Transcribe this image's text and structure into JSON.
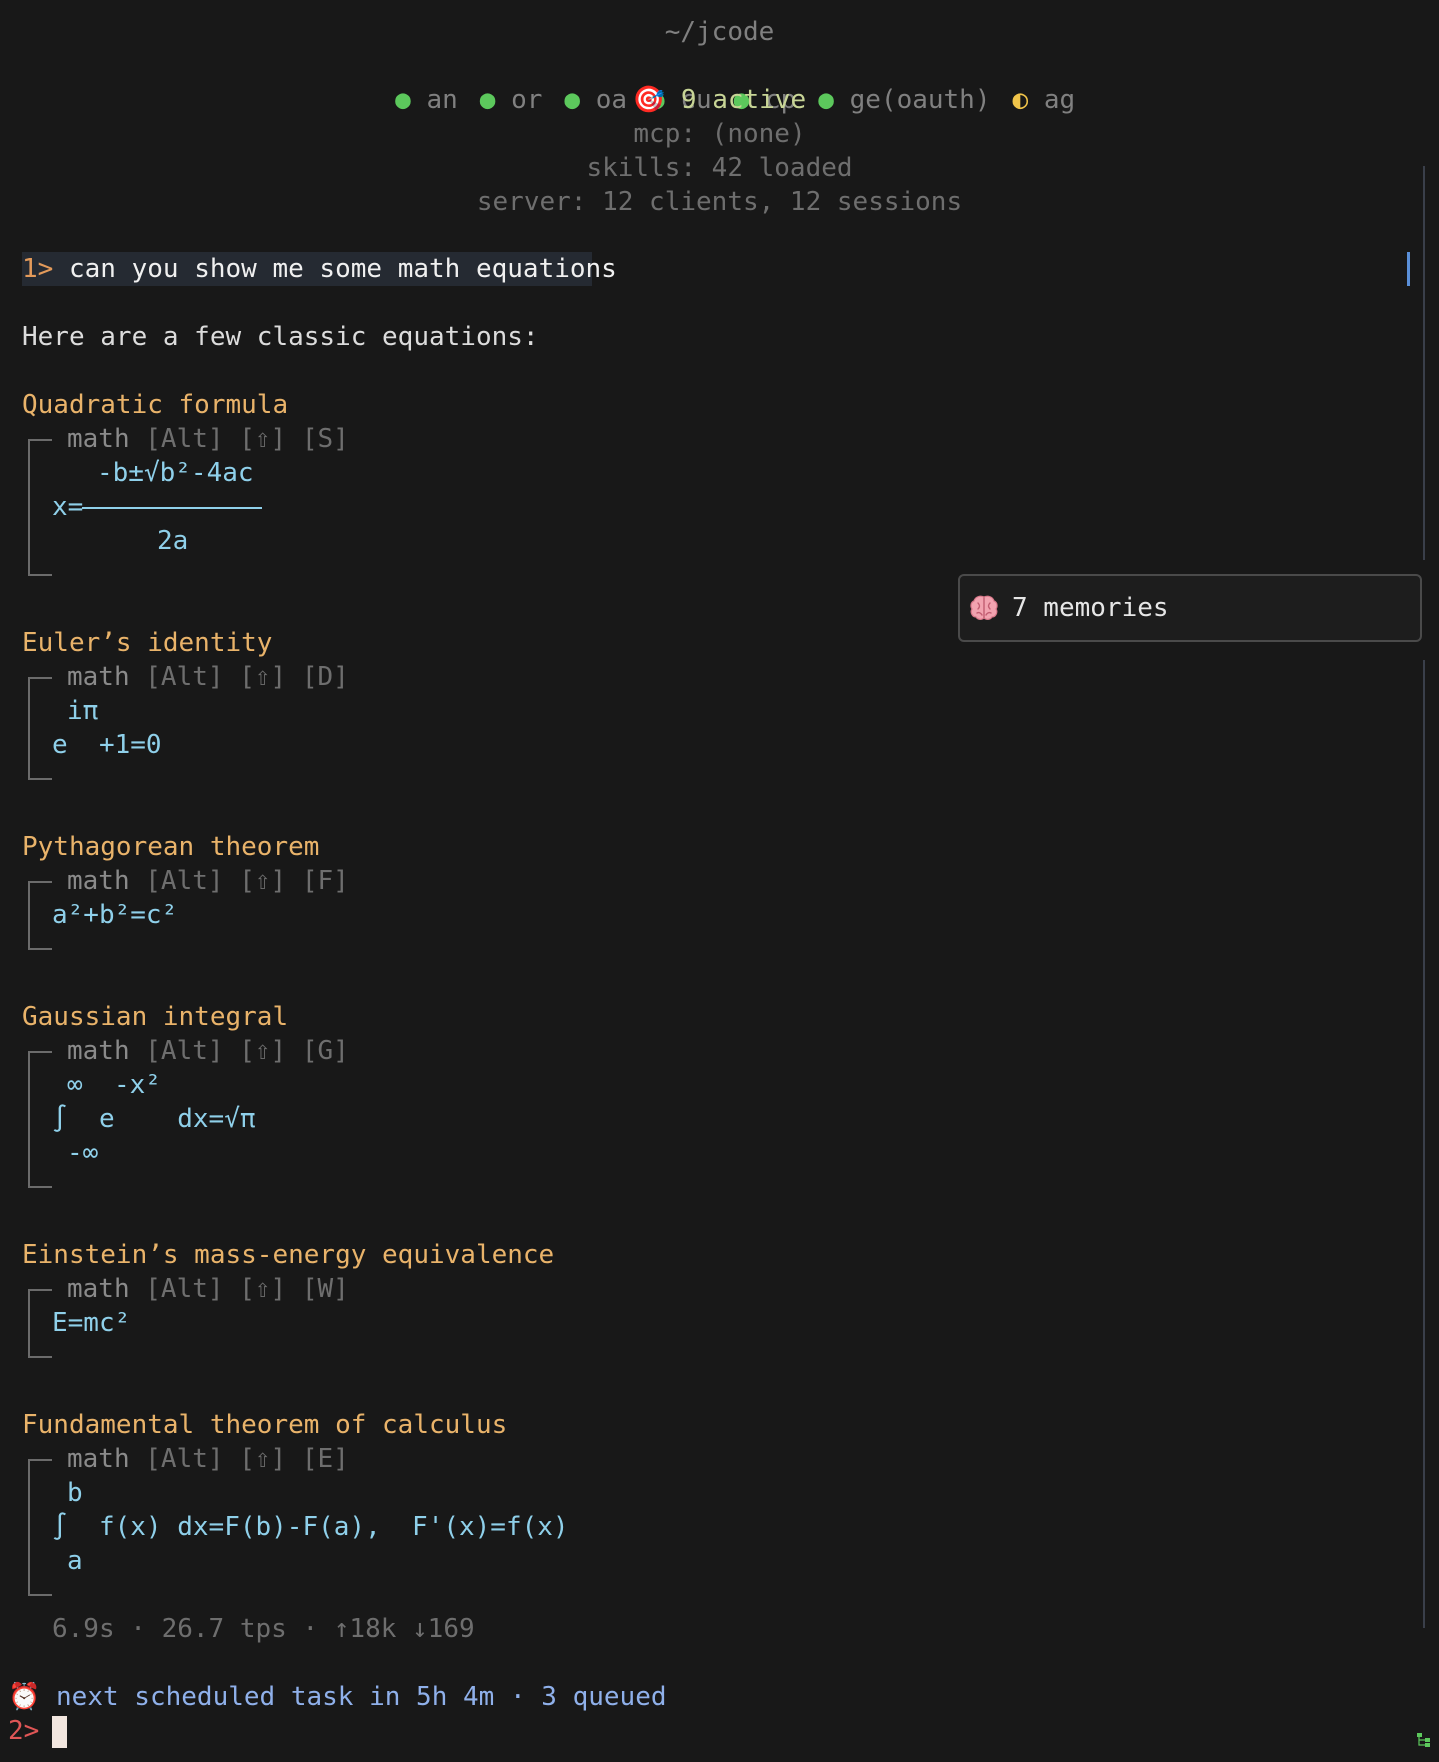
{
  "header": {
    "path": "~/jcode",
    "providers": [
      {
        "label": "an",
        "status": "ok"
      },
      {
        "label": "or",
        "status": "ok"
      },
      {
        "label": "oa",
        "status": "ok"
      },
      {
        "label": "cu",
        "status": "ok"
      },
      {
        "label": "cp",
        "status": "ok"
      },
      {
        "label": "ge(oauth)",
        "status": "ok"
      },
      {
        "label": "ag",
        "status": "partial"
      }
    ],
    "status_dot_glyph": "●",
    "status_partial_glyph": "◐",
    "active_icon": "target-icon",
    "active_glyph": "🎯",
    "active": "9 active",
    "mcp": "mcp: (none)",
    "skills": "skills: 42 loaded",
    "server": "server: 12 clients, 12 sessions"
  },
  "prompt1": {
    "number": "1>",
    "text": "can you show me some math equations"
  },
  "response": {
    "intro": "Here are a few classic equations:",
    "block_tag": "math",
    "block_keys": "[Alt] [⇧]",
    "equations": [
      {
        "title": "Quadratic formula",
        "key": "[S]",
        "numerator": "-b±√b²-4ac",
        "lhs": "x=",
        "denominator": "2a"
      },
      {
        "title": "Euler’s identity",
        "key": "[D]",
        "superscript": "iπ",
        "base": "e",
        "rest": "+1=0"
      },
      {
        "title": "Pythagorean theorem",
        "key": "[F]",
        "body": "a²+b²=c²"
      },
      {
        "title": "Gaussian integral",
        "key": "[G]",
        "upper": "∞",
        "exponent": "-x²",
        "integral": "∫",
        "integrand": "e",
        "result": "dx=√π",
        "lower": "-∞"
      },
      {
        "title": "Einstein’s mass-energy equivalence",
        "key": "[W]",
        "body": "E=mc²"
      },
      {
        "title": "Fundamental theorem of calculus",
        "key": "[E]",
        "upper": "b",
        "integral": "∫",
        "body": "f(x) dx=F(b)-F(a),  F'(x)=f(x)",
        "lower": "a"
      }
    ],
    "stats": "6.9s · 26.7 tps · ↑18k ↓169"
  },
  "memories": {
    "icon": "brain-icon",
    "label": "7 memories"
  },
  "footer": {
    "alarm_icon": "alarm-clock-icon",
    "alarm_glyph": "⏰",
    "scheduled": "next scheduled task in 5h 4m · 3 queued",
    "prompt_number": "2>"
  },
  "colors": {
    "background": "#181818",
    "heading": "#e9b36a",
    "math": "#8fd0ea",
    "ok_dot": "#5cc85c",
    "partial_dot": "#f0c44a",
    "active": "#c8d596",
    "prompt_number": "#e39a5a",
    "input_prompt": "#e05656",
    "scheduled": "#8fb0ea"
  }
}
